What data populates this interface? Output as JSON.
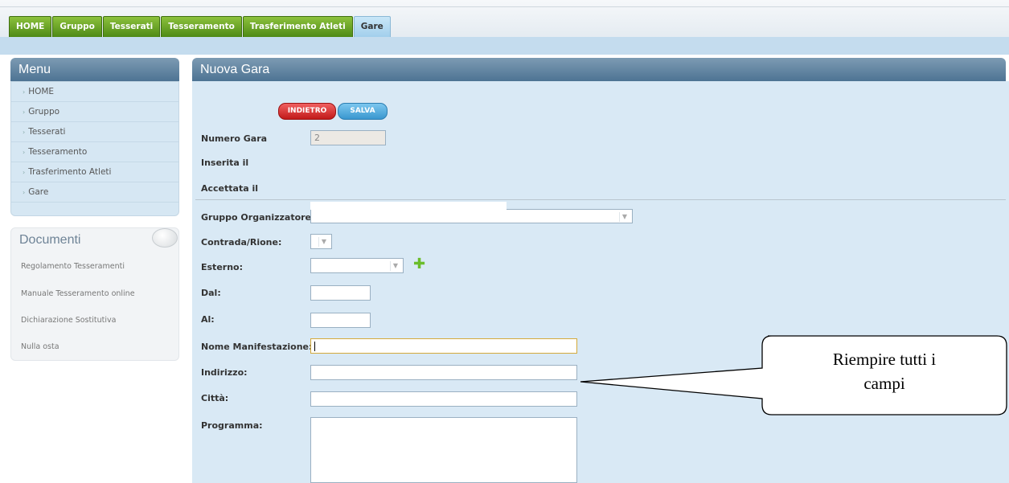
{
  "nav": {
    "tabs": [
      "HOME",
      "Gruppo",
      "Tesserati",
      "Tesseramento",
      "Trasferimento Atleti",
      "Gare"
    ],
    "active": "Gare"
  },
  "sidebar": {
    "title": "Menu",
    "items": [
      "HOME",
      "Gruppo",
      "Tesserati",
      "Tesseramento",
      "Trasferimento Atleti",
      "Gare"
    ]
  },
  "documents": {
    "title": "Documenti",
    "links": [
      "Regolamento Tesseramenti",
      "Manuale Tesseramento online",
      "Dichiarazione Sostitutiva",
      "Nulla osta"
    ]
  },
  "main": {
    "title": "Nuova Gara",
    "buttons": {
      "back": "INDIETRO",
      "save": "SALVA"
    },
    "fields": {
      "numero_label": "Numero Gara",
      "numero_value": "2",
      "inserita_label": "Inserita il",
      "accettata_label": "Accettata il",
      "gruppo_label": "Gruppo Organizzatore:",
      "contrada_label": "Contrada/Rione:",
      "esterno_label": "Esterno:",
      "dal_label": "Dal:",
      "al_label": "Al:",
      "nome_label": "Nome Manifestazione:",
      "indirizzo_label": "Indirizzo:",
      "citta_label": "Città:",
      "programma_label": "Programma:"
    }
  },
  "callout": {
    "line1": "Riempire tutti i",
    "line2": "campi"
  }
}
